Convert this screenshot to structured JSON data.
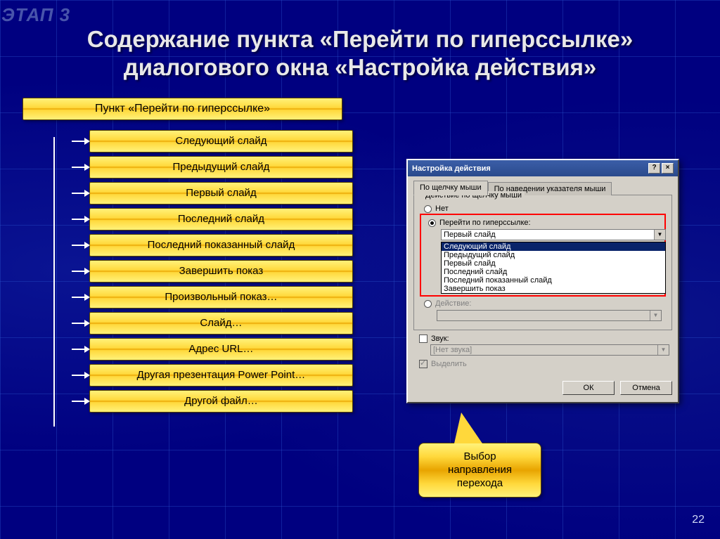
{
  "watermark": "ЭТАП 3",
  "title_line1": "Содержание пункта «Перейти по гиперссылке»",
  "title_line2": "диалогового окна «Настройка действия»",
  "root_bar": "Пункт «Перейти по гиперссылке»",
  "items": [
    "Следующий слайд",
    "Предыдущий слайд",
    "Первый слайд",
    "Последний слайд",
    "Последний показанный слайд",
    "Завершить показ",
    "Произвольный показ…",
    "Слайд…",
    "Адрес URL…",
    "Другая презентация Power Point…",
    "Другой файл…"
  ],
  "dialog": {
    "title": "Настройка действия",
    "help_icon": "?",
    "close_icon": "×",
    "tab_click": "По щелчку мыши",
    "tab_hover": "По наведении указателя мыши",
    "group_label": "Действие по щелчку мыши",
    "radio_none": "Нет",
    "radio_hyperlink": "Перейти по гиперссылке:",
    "combo_value": "Первый слайд",
    "list": [
      "Следующий слайд",
      "Предыдущий слайд",
      "Первый слайд",
      "Последний слайд",
      "Последний показанный слайд",
      "Завершить показ"
    ],
    "radio_action": "Действие:",
    "chk_sound": "Звук:",
    "sound_value": "[Нет звука]",
    "chk_highlight": "Выделить",
    "btn_ok": "ОК",
    "btn_cancel": "Отмена"
  },
  "callout": {
    "l1": "Выбор",
    "l2": "направления",
    "l3": "перехода"
  },
  "page_number": "22"
}
